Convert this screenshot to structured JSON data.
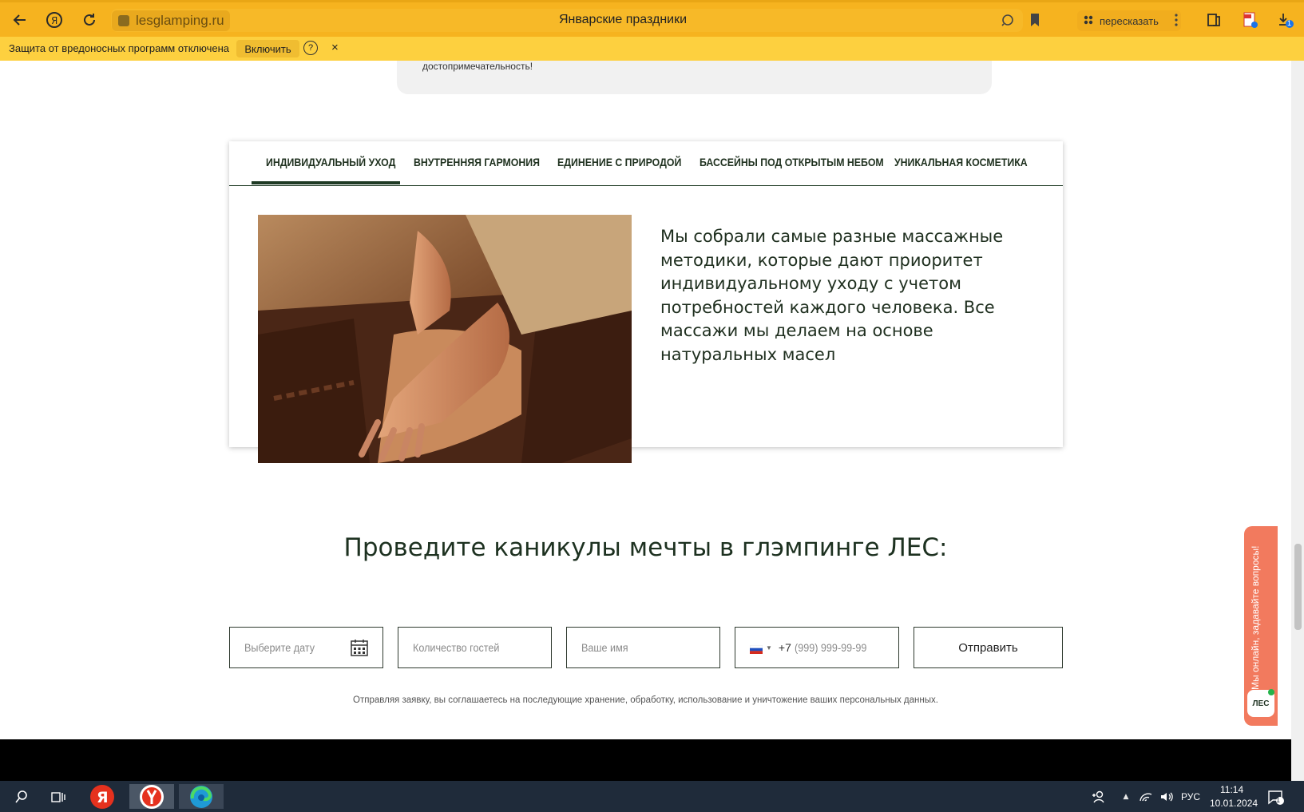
{
  "browser": {
    "url": "lesglamping.ru",
    "title": "Январские праздники",
    "retell_label": "пересказать",
    "download_badge": "1"
  },
  "warning_bar": {
    "text": "Защита от вредоносных программ отключена",
    "enable_button": "Включить",
    "help_glyph": "?",
    "close_glyph": "×"
  },
  "top_card": {
    "text": "достопримечательность!"
  },
  "tabs": {
    "items": [
      {
        "label": "ИНДИВИДУАЛЬНЫЙ УХОД",
        "active": true
      },
      {
        "label": "ВНУТРЕННЯЯ ГАРМОНИЯ",
        "active": false
      },
      {
        "label": "ЕДИНЕНИЕ С ПРИРОДОЙ",
        "active": false
      },
      {
        "label": "БАССЕЙНЫ ПОД ОТКРЫТЫМ НЕБОМ",
        "active": false
      },
      {
        "label": "УНИКАЛЬНАЯ КОСМЕТИКА",
        "active": false
      }
    ],
    "active_description": "Мы собрали самые разные массажные методики, которые дают приоритет индивидуальному уходу с учетом потребностей каждого человека. Все массажи мы делаем на основе натуральных масел"
  },
  "booking": {
    "headline": "Проведите каникулы мечты в глэмпинге ЛЕС:",
    "date_placeholder": "Выберите дату",
    "guests_placeholder": "Количество гостей",
    "name_placeholder": "Ваше имя",
    "phone_prefix": "+7",
    "phone_placeholder": "(999) 999-99-99",
    "submit_label": "Отправить",
    "consent": "Отправляя заявку, вы соглашаетесь на последующие хранение, обработку, использование и уничтожение ваших персональных данных."
  },
  "chat_widget": {
    "text": "Мы онлайн, задавайте вопросы!",
    "logo": "ЛЕС"
  },
  "taskbar": {
    "language": "РУС",
    "time": "11:14",
    "date": "10.01.2024",
    "notification_count": "1"
  },
  "colors": {
    "browser_bar": "#f6b31f",
    "warning_bar": "#fdd03f",
    "brand_green": "#1e3a24",
    "chat_widget": "#f27a5e",
    "taskbar": "#1f2b3a"
  }
}
